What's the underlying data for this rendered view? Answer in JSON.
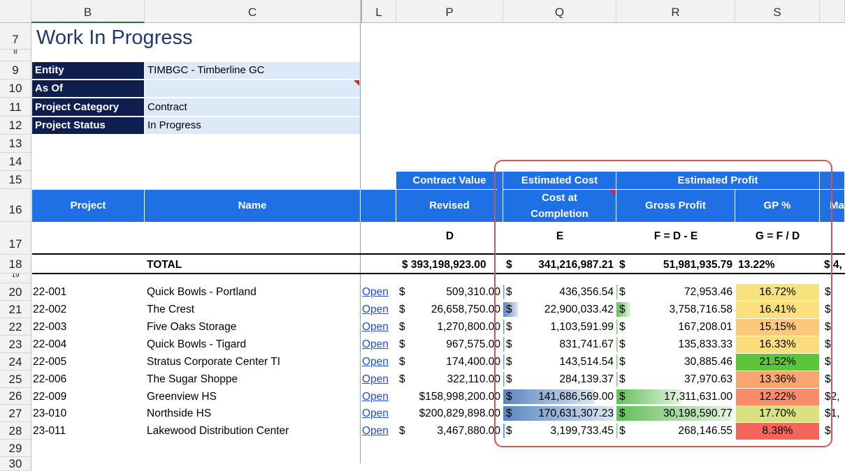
{
  "columns": [
    "B",
    "C",
    "L",
    "P",
    "Q",
    "R",
    "S"
  ],
  "rows": [
    "7",
    "8",
    "9",
    "10",
    "11",
    "12",
    "13",
    "14",
    "15",
    "16",
    "17",
    "18",
    "19",
    "20",
    "21",
    "22",
    "23",
    "24",
    "25",
    "26",
    "27",
    "28",
    "29",
    "30"
  ],
  "title": "Work In Progress",
  "filters": [
    {
      "label": "Entity",
      "value": "TIMBGC - Timberline GC"
    },
    {
      "label": "As Of",
      "value": ""
    },
    {
      "label": "Project Category",
      "value": "Contract"
    },
    {
      "label": "Project Status",
      "value": "In Progress"
    }
  ],
  "group_headers": {
    "contract_value": "Contract Value",
    "estimated_cost": "Estimated Cost",
    "estimated_profit": "Estimated Profit"
  },
  "headers": {
    "project": "Project",
    "name": "Name",
    "revised": "Revised",
    "cost_at_completion": "Cost at Completion",
    "gross_profit": "Gross Profit",
    "gp_pct": "GP %",
    "next_partial": "Ma"
  },
  "formulas": {
    "revised": "D",
    "cost": "E",
    "profit": "F = D - E",
    "gp": "G = F / D"
  },
  "total": {
    "label": "TOTAL",
    "revised": "$ 393,198,923.00",
    "cost_symbol": "$",
    "cost": "341,216,987.21",
    "profit_symbol": "$",
    "profit": "51,981,935.79",
    "gp": "13.22%",
    "next_partial": "$ 4,"
  },
  "link_label": "Open",
  "dollar": "$",
  "projects": [
    {
      "id": "22-001",
      "name": "Quick Bowls - Portland",
      "revised": "509,310.00",
      "cost": "436,356.54",
      "profit": "72,953.46",
      "gp": "16.72%",
      "gp_color": "#f8e27c",
      "cost_frac": 0.003,
      "profit_frac": 0.002,
      "next": "$"
    },
    {
      "id": "22-002",
      "name": "The Crest",
      "revised": "26,658,750.00",
      "cost": "22,900,033.42",
      "profit": "3,758,716.58",
      "gp": "16.41%",
      "gp_color": "#fbe07b",
      "cost_frac": 0.13,
      "profit_frac": 0.12,
      "next": "$"
    },
    {
      "id": "22-003",
      "name": "Five Oaks Storage",
      "revised": "1,270,800.00",
      "cost": "1,103,591.99",
      "profit": "167,208.01",
      "gp": "15.15%",
      "gp_color": "#fcc87a",
      "cost_frac": 0.006,
      "profit_frac": 0.005,
      "next": "$"
    },
    {
      "id": "22-004",
      "name": "Quick Bowls - Tigard",
      "revised": "967,575.00",
      "cost": "831,741.67",
      "profit": "135,833.33",
      "gp": "16.33%",
      "gp_color": "#fbdd7b",
      "cost_frac": 0.005,
      "profit_frac": 0.004,
      "next": "$"
    },
    {
      "id": "22-005",
      "name": "Stratus Corporate Center TI",
      "revised": "174,400.00",
      "cost": "143,514.54",
      "profit": "30,885.46",
      "gp": "21.52%",
      "gp_color": "#5cc43a",
      "cost_frac": 0.001,
      "profit_frac": 0.001,
      "next": "$"
    },
    {
      "id": "22-006",
      "name": "The Sugar Shoppe",
      "revised": "322,110.00",
      "cost": "284,139.37",
      "profit": "37,970.63",
      "gp": "13.36%",
      "gp_color": "#f9a56f",
      "cost_frac": 0.002,
      "profit_frac": 0.001,
      "next": "$"
    },
    {
      "id": "22-009",
      "name": "Greenview HS",
      "revised": "$158,998,200.00",
      "cost": "141,686,569.00",
      "profit": "17,311,631.00",
      "gp": "12.22%",
      "gp_color": "#f88c6b",
      "cost_frac": 0.83,
      "profit_frac": 0.57,
      "next": "$2,"
    },
    {
      "id": "23-010",
      "name": "Northside HS",
      "revised": "$200,829,898.00",
      "cost": "170,631,307.23",
      "profit": "30,198,590.77",
      "gp": "17.70%",
      "gp_color": "#d8e27e",
      "cost_frac": 1.0,
      "profit_frac": 1.0,
      "next": "$1,"
    },
    {
      "id": "23-011",
      "name": "Lakewood Distribution Center",
      "revised": "3,467,880.00",
      "cost": "3,199,733.45",
      "profit": "268,146.55",
      "gp": "8.38%",
      "gp_color": "#f4655c",
      "cost_frac": 0.02,
      "profit_frac": 0.01,
      "next": "$"
    }
  ],
  "colors": {
    "header_blue": "#1f6fe5",
    "label_navy": "#0e1f4f",
    "value_blue": "#dce9f8",
    "highlight_border": "#d9534f",
    "cost_bar": "#5a86bf",
    "profit_bar": "#63be5a"
  }
}
